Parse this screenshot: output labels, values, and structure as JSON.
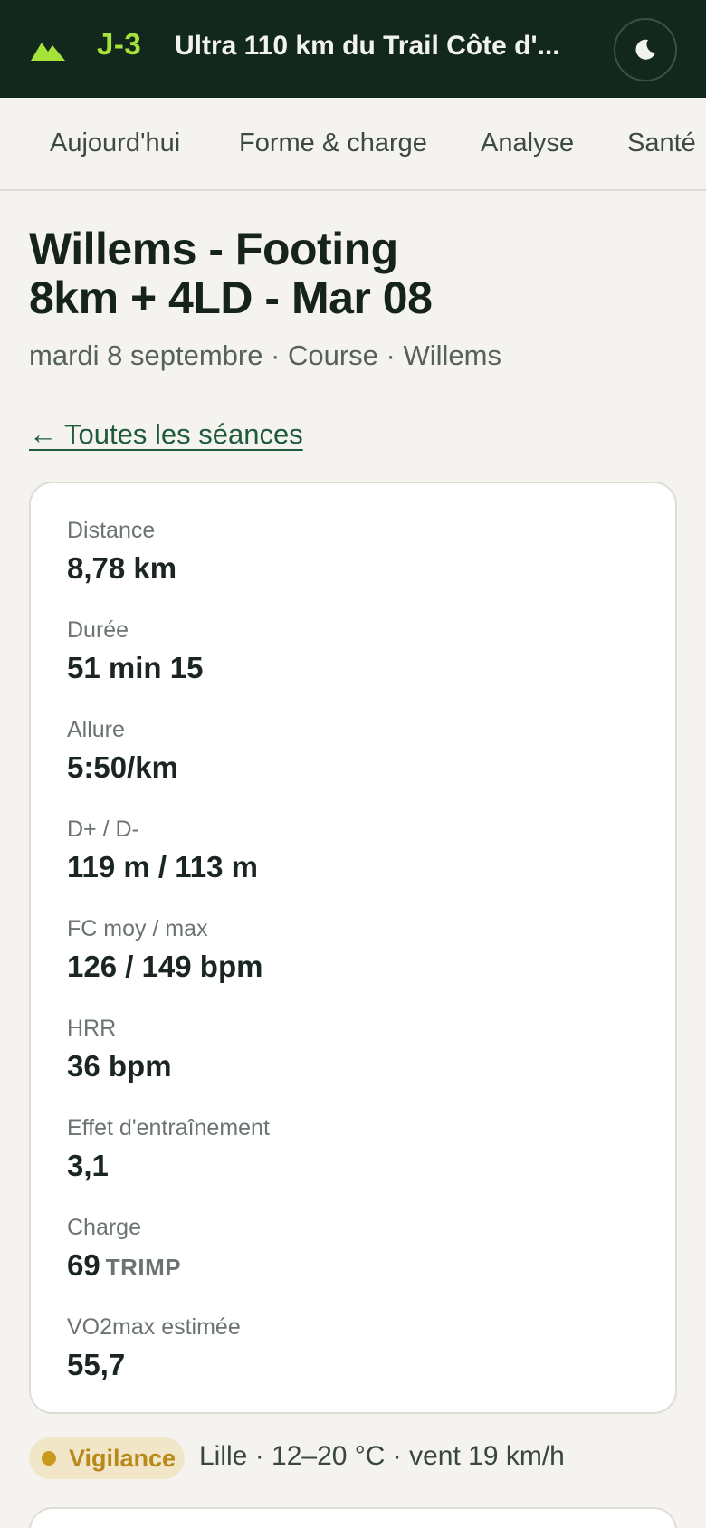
{
  "header": {
    "countdown": "J-3",
    "race_title": "Ultra 110 km du Trail Côte d'...",
    "logo_icon": "mountain-icon",
    "theme_icon": "moon-icon",
    "brand_color": "#a6e33a",
    "bg_color": "#12281c"
  },
  "tabs": [
    {
      "label": "Aujourd'hui"
    },
    {
      "label": "Forme & charge"
    },
    {
      "label": "Analyse"
    },
    {
      "label": "Santé"
    }
  ],
  "session": {
    "title_line1": "Willems - Footing",
    "title_line2": "8km + 4LD - Mar 08",
    "subtitle": "mardi 8 septembre · Course · Willems",
    "back_label": "← Toutes les séances"
  },
  "stats": [
    {
      "label": "Distance",
      "value": "8,78 km"
    },
    {
      "label": "Durée",
      "value": "51 min 15"
    },
    {
      "label": "Allure",
      "value": "5:50/km"
    },
    {
      "label": "D+ / D-",
      "value": "119 m / 113 m"
    },
    {
      "label": "FC moy / max",
      "value": "126 / 149 bpm"
    },
    {
      "label": "HRR",
      "value": "36 bpm"
    },
    {
      "label": "Effet d'entraînement",
      "value": "3,1"
    },
    {
      "label": "Charge",
      "value": "69",
      "unit": "TRIMP"
    },
    {
      "label": "VO2max estimée",
      "value": "55,7"
    }
  ],
  "weather": {
    "badge": "Vigilance",
    "badge_color": "#c89a1e",
    "text": "Lille · 12–20 °C · vent 19 km/h"
  }
}
